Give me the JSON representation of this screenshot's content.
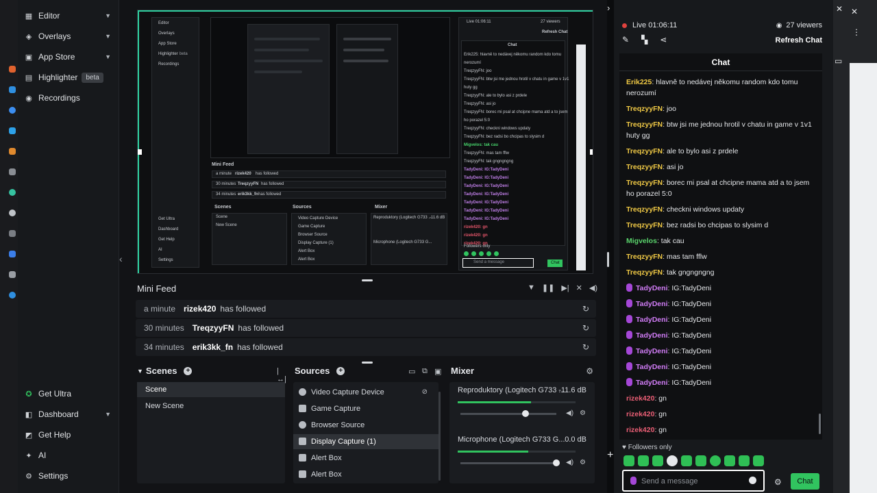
{
  "sidebar": {
    "items": [
      {
        "label": "Editor",
        "icon": "editor-icon",
        "chevron": true
      },
      {
        "label": "Overlays",
        "icon": "overlays-icon",
        "chevron": true
      },
      {
        "label": "App Store",
        "icon": "app-store-icon",
        "chevron": true
      },
      {
        "label": "Highlighter",
        "icon": "highlighter-icon",
        "badge": "beta"
      },
      {
        "label": "Recordings",
        "icon": "recordings-icon"
      }
    ],
    "bottom": [
      {
        "label": "Get Ultra",
        "icon": "ultra-icon"
      },
      {
        "label": "Dashboard",
        "icon": "dashboard-icon",
        "chevron": true
      },
      {
        "label": "Get Help",
        "icon": "help-icon"
      },
      {
        "label": "AI",
        "icon": "ai-sparkle-icon"
      },
      {
        "label": "Settings",
        "icon": "gear-icon"
      }
    ]
  },
  "minifeed": {
    "title": "Mini Feed",
    "rows": [
      {
        "time": "a minute",
        "user": "rizek420",
        "action": "has followed"
      },
      {
        "time": "30 minutes",
        "user": "TreqzyyFN",
        "action": "has followed"
      },
      {
        "time": "34 minutes",
        "user": "erik3kk_fn",
        "action": "has followed"
      }
    ]
  },
  "scenes": {
    "title": "Scenes",
    "items": [
      "Scene",
      "New Scene"
    ]
  },
  "sources": {
    "title": "Sources",
    "items": [
      "Video Capture Device",
      "Game Capture",
      "Browser Source",
      "Display Capture (1)",
      "Alert Box",
      "Alert Box"
    ]
  },
  "mixer": {
    "title": "Mixer",
    "channels": [
      {
        "name": "Reproduktory (Logitech G733 ...",
        "db": "-11.6 dB",
        "level": 0.62,
        "volume": 0.68
      },
      {
        "name": "Microphone (Logitech G733 G...",
        "db": "0.0 dB",
        "level": 0.6,
        "volume": 1.0
      }
    ]
  },
  "chatpanel": {
    "live": "Live 01:06:11",
    "viewers": "27 viewers",
    "refresh": "Refresh Chat",
    "header": "Chat",
    "followers_only": "Followers only",
    "input_placeholder": "Send a message",
    "send_label": "Chat"
  },
  "chat": {
    "messages": [
      {
        "name": "Erik225",
        "color": "y",
        "text": "hlavně to nedávej někomu random kdo tomu nerozumí",
        "lines": 2
      },
      {
        "name": "TreqzyyFN",
        "color": "y",
        "text": "joo",
        "lines": 1
      },
      {
        "name": "TreqzyyFN",
        "color": "y",
        "text": "btw jsi me jednou hrotil v chatu in game v 1v1 huty gg",
        "lines": 2
      },
      {
        "name": "TreqzyyFN",
        "color": "y",
        "text": "ale to bylo asi z prdele",
        "lines": 1
      },
      {
        "name": "TreqzyyFN",
        "color": "y",
        "text": "asi jo",
        "lines": 1
      },
      {
        "name": "TreqzyyFN",
        "color": "y",
        "text": "borec mi psal at chcipne mama atd a to jsem ho porazel 5:0",
        "lines": 2
      },
      {
        "name": "TreqzyyFN",
        "color": "y",
        "text": "checkni windows updaty",
        "lines": 1
      },
      {
        "name": "TreqzyyFN",
        "color": "y",
        "text": "bez radsi bo chcipas to slysim d",
        "lines": 1
      },
      {
        "name": "Migvelos",
        "color": "g",
        "text": "tak cau",
        "lines": 1
      },
      {
        "name": "TreqzyyFN",
        "color": "y",
        "text": "mas tam fflw",
        "lines": 1
      },
      {
        "name": "TreqzyyFN",
        "color": "y",
        "text": "tak gngngngng",
        "lines": 1
      },
      {
        "name": "TadyDeni",
        "color": "p",
        "text": "IG:TadyDeni",
        "lines": 1,
        "badge": true
      },
      {
        "name": "TadyDeni",
        "color": "p",
        "text": "IG:TadyDeni",
        "lines": 1,
        "badge": true
      },
      {
        "name": "TadyDeni",
        "color": "p",
        "text": "IG:TadyDeni",
        "lines": 1,
        "badge": true
      },
      {
        "name": "TadyDeni",
        "color": "p",
        "text": "IG:TadyDeni",
        "lines": 1,
        "badge": true
      },
      {
        "name": "TadyDeni",
        "color": "p",
        "text": "IG:TadyDeni",
        "lines": 1,
        "badge": true
      },
      {
        "name": "TadyDeni",
        "color": "p",
        "text": "IG:TadyDeni",
        "lines": 1,
        "badge": true
      },
      {
        "name": "TadyDeni",
        "color": "p",
        "text": "IG:TadyDeni",
        "lines": 1,
        "badge": true
      },
      {
        "name": "rizek420",
        "color": "r",
        "text": "gn",
        "lines": 1
      },
      {
        "name": "rizek420",
        "color": "r",
        "text": "gn",
        "lines": 1
      },
      {
        "name": "rizek420",
        "color": "r",
        "text": "gn",
        "lines": 1
      }
    ]
  },
  "preview_mini": {
    "chat_title": "Chat",
    "live": "Live 01:06:11",
    "viewers": "27 viewers",
    "refresh": "Refresh Chat",
    "minifeed": "Mini Feed",
    "feed_rows": [
      {
        "time": "a minute",
        "user": "rizek420",
        "action": "has followed"
      },
      {
        "time": "30 minutes",
        "user": "TreqzyyFN",
        "action": "has followed"
      },
      {
        "time": "34 minutes",
        "user": "erik3kk_fn",
        "action": "has followed"
      }
    ],
    "scenes": "Scenes",
    "sources": "Sources",
    "mixer": "Mixer",
    "scene_items": [
      "Scene",
      "New Scene"
    ],
    "source_items": [
      "Video Capture Device",
      "Game Capture",
      "Browser Source",
      "Display Capture (1)",
      "Alert Box",
      "Alert Box"
    ],
    "mix_items": [
      "Reproduktory (Logitech G733 ...",
      "Microphone (Logitech G733 G..."
    ],
    "mix_db": "-11.6 dB",
    "side_items": [
      "Editor",
      "Overlays",
      "App Store",
      "Highlighter",
      "Recordings"
    ],
    "side_bottom": [
      "Get Ultra",
      "Dashboard",
      "Get Help",
      "AI",
      "Settings"
    ],
    "beta": "beta",
    "chat_lines": [
      "Erik225: hlavně to nedávej někomu random kdo tomu",
      "nerozumí",
      "TreqzyyFN: joo",
      "TreqzyyFN: btw jsi me jednou hrotil v chatu in game v 1v1",
      "huty gg",
      "TreqzyyFN: ale to bylo asi z prdele",
      "TreqzyyFN: asi jo",
      "TreqzyyFN: borec mi psal at chcipne mama atd a to jsem",
      "ho porazel 5:0",
      "TreqzyyFN: checkni windows updaty",
      "TreqzyyFN: bez radsi bo chcipas to slysim d",
      "Migvelos: tak cau",
      "TreqzyyFN: mas tam fflw",
      "TreqzyyFN: tak gngngngng",
      "TadyDeni: IG:TadyDeni",
      "TadyDeni: IG:TadyDeni",
      "TadyDeni: IG:TadyDeni",
      "TadyDeni: IG:TadyDeni",
      "TadyDeni: IG:TadyDeni",
      "TadyDeni: IG:TadyDeni",
      "TadyDeni: IG:TadyDeni",
      "rizek420: gn",
      "rizek420: gn",
      "rizek420: gn"
    ],
    "followers_only": "Followers only",
    "placeholder": "Send a message",
    "send": "Chat"
  },
  "colors": {
    "accent_green": "#31c45f",
    "name_yellow": "#f0c945",
    "name_green": "#5ad46c",
    "name_red": "#ec5f76",
    "name_purple": "#d07cf5",
    "live_red": "#e0423e"
  }
}
